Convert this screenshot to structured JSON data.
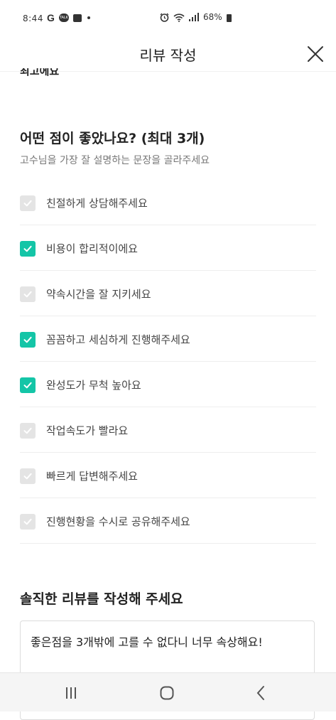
{
  "status_bar": {
    "time": "8:44",
    "notif_g": "G",
    "notif_talk": "TALK",
    "battery": "68%"
  },
  "header": {
    "title": "리뷰 작성"
  },
  "cut_text": "최고에요",
  "section_good": {
    "title": "어떤 점이 좋았나요? (최대 3개)",
    "subtitle": "고수님을 가장 잘 설명하는 문장을 골라주세요",
    "options": [
      {
        "label": "친절하게 상담해주세요",
        "checked": false
      },
      {
        "label": "비용이 합리적이에요",
        "checked": true
      },
      {
        "label": "약속시간을 잘 지키세요",
        "checked": false
      },
      {
        "label": "꼼꼼하고 세심하게 진행해주세요",
        "checked": true
      },
      {
        "label": "완성도가 무척 높아요",
        "checked": true
      },
      {
        "label": "작업속도가 빨라요",
        "checked": false
      },
      {
        "label": "빠르게 답변해주세요",
        "checked": false
      },
      {
        "label": "진행현황을 수시로 공유해주세요",
        "checked": false
      }
    ]
  },
  "section_review": {
    "title": "솔직한 리뷰를 작성해 주세요",
    "text": "좋은점을 3개밖에 고를 수 없다니 너무 속상해요!"
  },
  "colors": {
    "accent": "#14c5a7",
    "unchecked": "#e4e4e4"
  }
}
